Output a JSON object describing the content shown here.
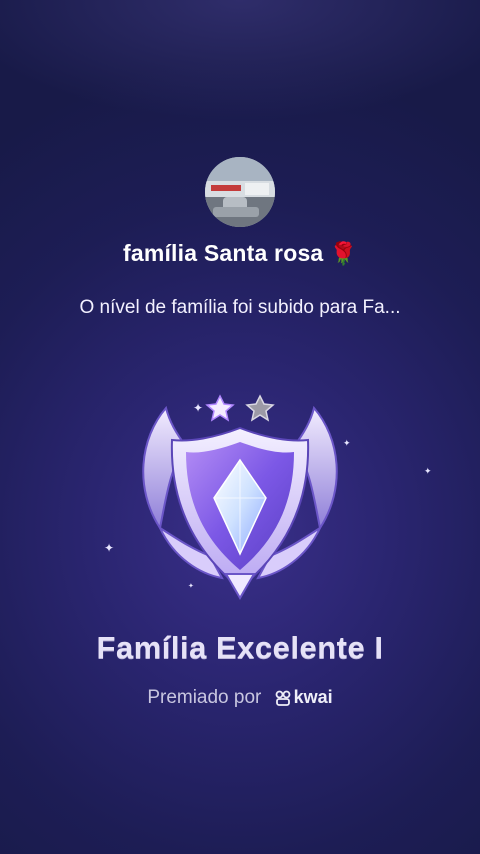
{
  "profile": {
    "family_name": "família Santa rosa",
    "emoji": "🌹",
    "message": "O nível de família foi subido para Fa..."
  },
  "badge": {
    "title": "Família Excelente I",
    "stars_filled": 1,
    "stars_total": 2,
    "icon": "shield-crystal-badge"
  },
  "award": {
    "prefix": "Premiado por",
    "brand": "kwai"
  },
  "colors": {
    "background": "#1f1f5a",
    "badge_purple": "#8b6cf0"
  }
}
